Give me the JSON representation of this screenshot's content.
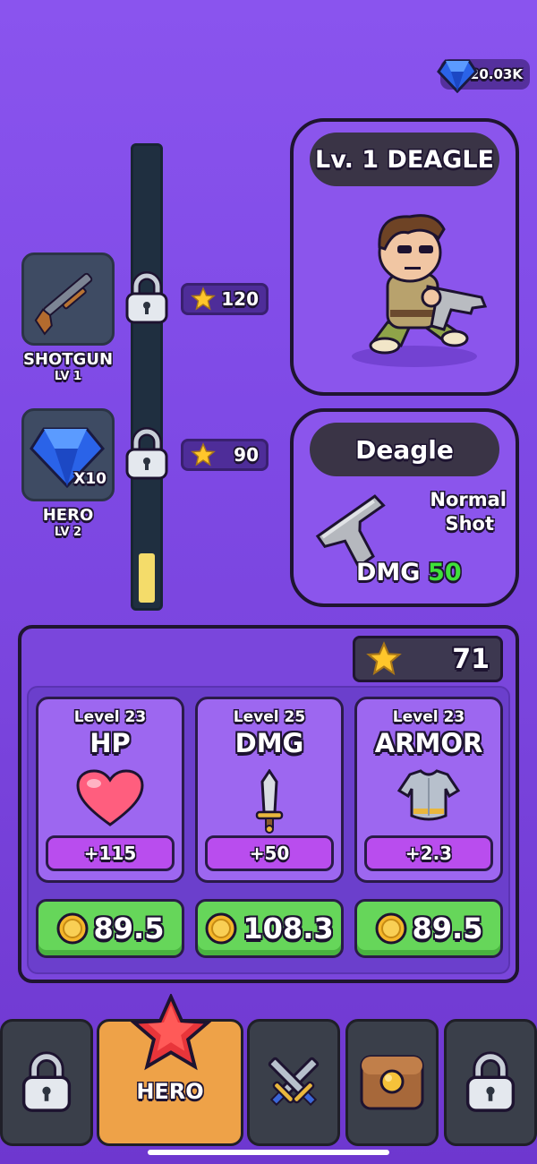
{
  "currency": {
    "gems": "20.03K",
    "icon": "blue-gem-icon"
  },
  "rewards": [
    {
      "name": "SHOTGUN",
      "level": "LV 1",
      "cost": "120",
      "icon": "shotgun-icon",
      "locked": true
    },
    {
      "name": "HERO",
      "level": "LV 2",
      "cost": "90",
      "icon": "blue-gem-icon",
      "quantity": "X10",
      "locked": true
    }
  ],
  "progress": {
    "fill_fraction": 0.11
  },
  "hero_card": {
    "title": "Lv. 1 DEAGLE",
    "icon": "hero-character"
  },
  "weapon_card": {
    "title": "Deagle",
    "shot_type_line1": "Normal",
    "shot_type_line2": "Shot",
    "dmg_label": "DMG",
    "dmg_value": "50",
    "dmg_color": "#3fe03a",
    "icon": "pistol-icon"
  },
  "upgrades": {
    "star_balance": "71",
    "stats": [
      {
        "level": "Level 23",
        "name": "HP",
        "bonus": "+115",
        "price": "89.5",
        "icon": "heart-icon"
      },
      {
        "level": "Level 25",
        "name": "DMG",
        "bonus": "+50",
        "price": "108.3",
        "icon": "sword-icon"
      },
      {
        "level": "Level 23",
        "name": "ARMOR",
        "bonus": "+2.3",
        "price": "89.5",
        "icon": "armor-icon"
      }
    ]
  },
  "nav": {
    "tabs": [
      {
        "name": "locked",
        "icon": "lock-icon"
      },
      {
        "name": "hero",
        "label": "HERO",
        "icon": "star-icon",
        "active": true
      },
      {
        "name": "battle",
        "icon": "crossed-swords-icon"
      },
      {
        "name": "chest",
        "icon": "chest-icon"
      },
      {
        "name": "locked",
        "icon": "lock-icon"
      }
    ]
  },
  "colors": {
    "background": "#8a54ee",
    "panel": "#7a46dc",
    "price_button": "#66d65a",
    "active_tab": "#eea248"
  }
}
